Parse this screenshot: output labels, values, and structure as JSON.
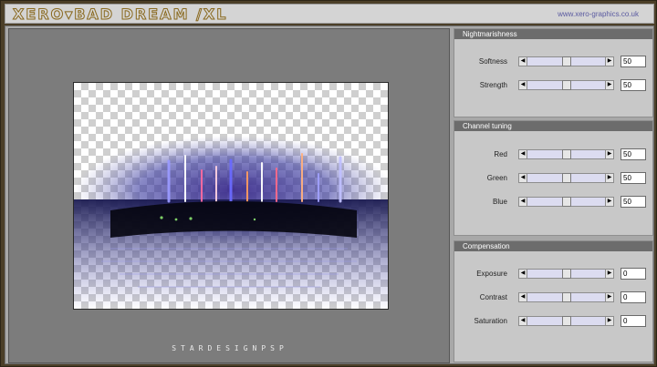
{
  "app": {
    "title": "XERO▾BAD DREAM /XL",
    "site": "www.xero-graphics.co.uk"
  },
  "preview": {
    "credit": "STARDESIGNPSP"
  },
  "panels": [
    {
      "title": "Nightmarishness",
      "controls": [
        {
          "label": "Softness",
          "value": "50",
          "fraction": 0.5
        },
        {
          "label": "Strength",
          "value": "50",
          "fraction": 0.5
        }
      ]
    },
    {
      "title": "Channel tuning",
      "controls": [
        {
          "label": "Red",
          "value": "50",
          "fraction": 0.5
        },
        {
          "label": "Green",
          "value": "50",
          "fraction": 0.5
        },
        {
          "label": "Blue",
          "value": "50",
          "fraction": 0.5
        }
      ]
    },
    {
      "title": "Compensation",
      "controls": [
        {
          "label": "Exposure",
          "value": "0",
          "fraction": 0.5
        },
        {
          "label": "Contrast",
          "value": "0",
          "fraction": 0.5
        },
        {
          "label": "Saturation",
          "value": "0",
          "fraction": 0.5
        }
      ]
    }
  ],
  "colors": {
    "frame": "#4b3f28",
    "panel_header": "#6c6c6c",
    "slider_track": "#dcdcf0",
    "title_outline": "#8a6a20"
  }
}
